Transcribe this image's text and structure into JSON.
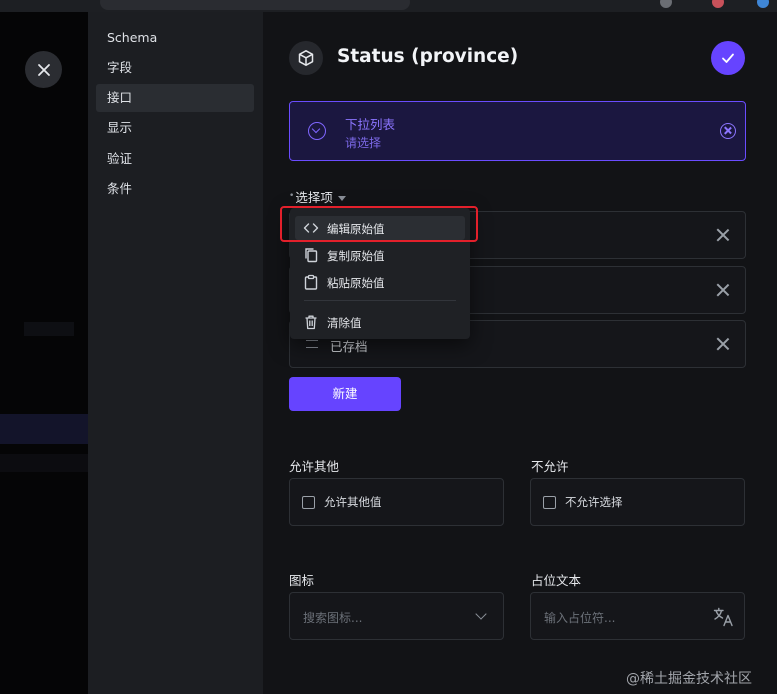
{
  "sidebar": {
    "items": [
      {
        "label": "Schema"
      },
      {
        "label": "字段"
      },
      {
        "label": "接口"
      },
      {
        "label": "显示"
      },
      {
        "label": "验证"
      },
      {
        "label": "条件"
      }
    ]
  },
  "header": {
    "title": "Status (province)"
  },
  "interface_select": {
    "name": "下拉列表",
    "sub": "请选择"
  },
  "choices": {
    "label": "选择项",
    "rows": [
      {
        "text": ""
      },
      {
        "text": ""
      },
      {
        "text": "已存档"
      }
    ]
  },
  "new_button": "新建",
  "allow_other": {
    "label": "允许其他",
    "checkbox": "允许其他值"
  },
  "allow_none": {
    "label": "不允许",
    "checkbox": "不允许选择"
  },
  "icon_field": {
    "label": "图标",
    "placeholder": "搜索图标..."
  },
  "placeholder_field": {
    "label": "占位文本",
    "placeholder": "输入占位符..."
  },
  "context_menu": {
    "items": [
      {
        "label": "编辑原始值",
        "icon": "code-icon"
      },
      {
        "label": "复制原始值",
        "icon": "copy-icon"
      },
      {
        "label": "粘贴原始值",
        "icon": "clipboard-icon"
      },
      {
        "label": "清除值",
        "icon": "trash-icon"
      }
    ]
  },
  "watermark": "@稀土掘金技术社区",
  "colors": {
    "accent": "#6644ff",
    "highlight": "#e3202b"
  }
}
